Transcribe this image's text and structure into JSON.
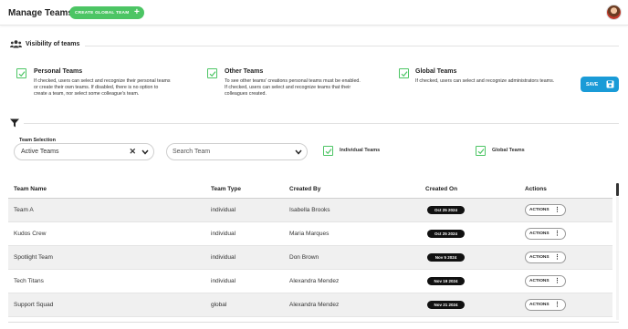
{
  "header": {
    "title": "Manage Teams",
    "create_button": "CREATE GLOBAL TEAM",
    "create_icon": "plus-icon",
    "avatar_icon": "user-avatar"
  },
  "visibility": {
    "title": "Visibility of teams",
    "icon": "users-icon",
    "options": [
      {
        "title": "Personal Teams",
        "desc": [
          "If checked, users can select and recognize their personal teams",
          "or create their own teams. If disabled, there is no option to",
          "create a team, nor select some colleague's team."
        ],
        "checked": true
      },
      {
        "title": "Other Teams",
        "desc": [
          "To see other teams' creations personal teams must be enabled.",
          "If checked, users can select and recognize teams that their",
          "colleagues created."
        ],
        "checked": true
      },
      {
        "title": "Global Teams",
        "desc": [
          "If checked, users can select and recognize administrators teams."
        ],
        "checked": true
      }
    ],
    "save_label": "SAVE",
    "save_icon": "floppy-disk-icon"
  },
  "filters": {
    "icon": "filter-icon",
    "team_selection_label": "Team Selection",
    "team_selection_value": "Active Teams",
    "search_placeholder": "Search Team",
    "individual_label": "Individual Teams",
    "global_label": "Global Teams"
  },
  "table": {
    "columns": [
      "Team Name",
      "Team Type",
      "Created By",
      "Created On",
      "Actions"
    ],
    "actions_label": "ACTIONS",
    "rows": [
      {
        "name": "Team A",
        "type": "individual",
        "created_by": "Isabella Brooks",
        "created_on": "Oct 25 2024"
      },
      {
        "name": "Kudos Crew",
        "type": "individual",
        "created_by": "Maria Marques",
        "created_on": "Oct 25 2024"
      },
      {
        "name": "Spotlight Team",
        "type": "individual",
        "created_by": "Don Brown",
        "created_on": "Nov 5 2024"
      },
      {
        "name": "Tech Titans",
        "type": "individual",
        "created_by": "Alexandra Mendez",
        "created_on": "Nov 19 2024"
      },
      {
        "name": "Support Squad",
        "type": "global",
        "created_by": "Alexandra Mendez",
        "created_on": "Nov 21 2024"
      }
    ]
  },
  "colors": {
    "accent_green": "#4cc564",
    "save_blue": "#1a9bd7",
    "date_pill": "#111111",
    "row_grey": "#f0f0f0"
  }
}
